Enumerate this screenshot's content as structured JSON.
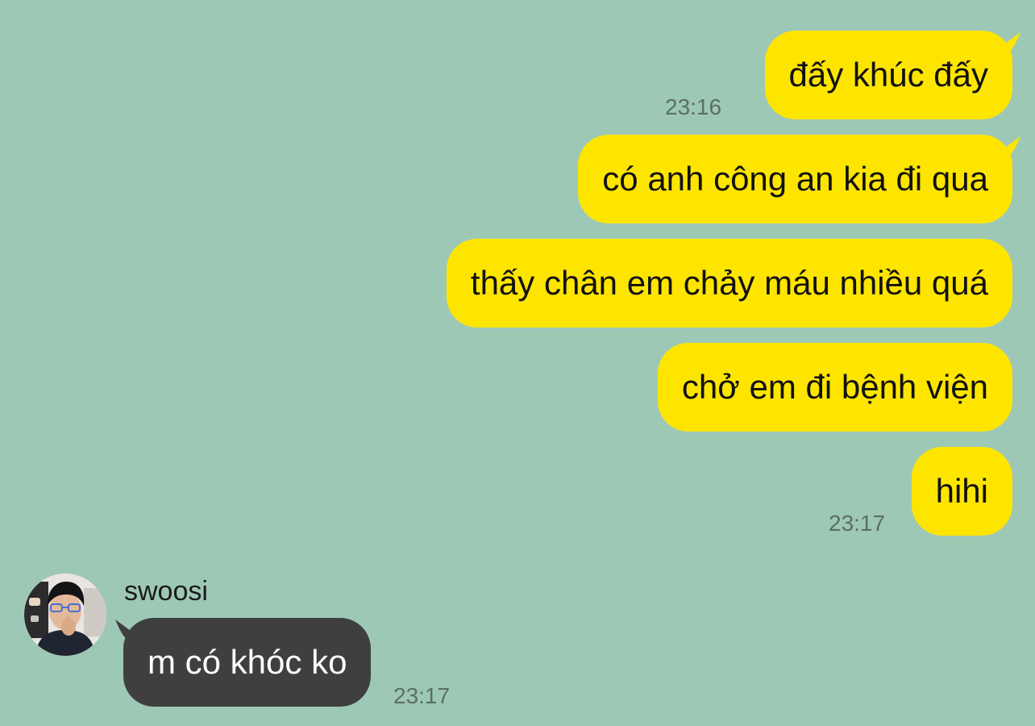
{
  "chat": {
    "colors": {
      "background": "#9ec8b6",
      "outgoing_bubble": "#fee500",
      "incoming_bubble": "#3f3f40",
      "timestamp": "#5b6e67"
    },
    "outgoing": [
      {
        "text": "đấy khúc đấy",
        "time": "23:16"
      },
      {
        "text": "có anh công an kia đi qua",
        "time": ""
      },
      {
        "text": "thấy chân em chảy máu nhiều quá",
        "time": ""
      },
      {
        "text": "chở em đi bệnh viện",
        "time": ""
      },
      {
        "text": "hihi",
        "time": "23:17"
      }
    ],
    "incoming": {
      "sender": "swoosi",
      "avatar_icon": "user-avatar-photo",
      "message": "m có khóc ko",
      "time": "23:17"
    }
  }
}
